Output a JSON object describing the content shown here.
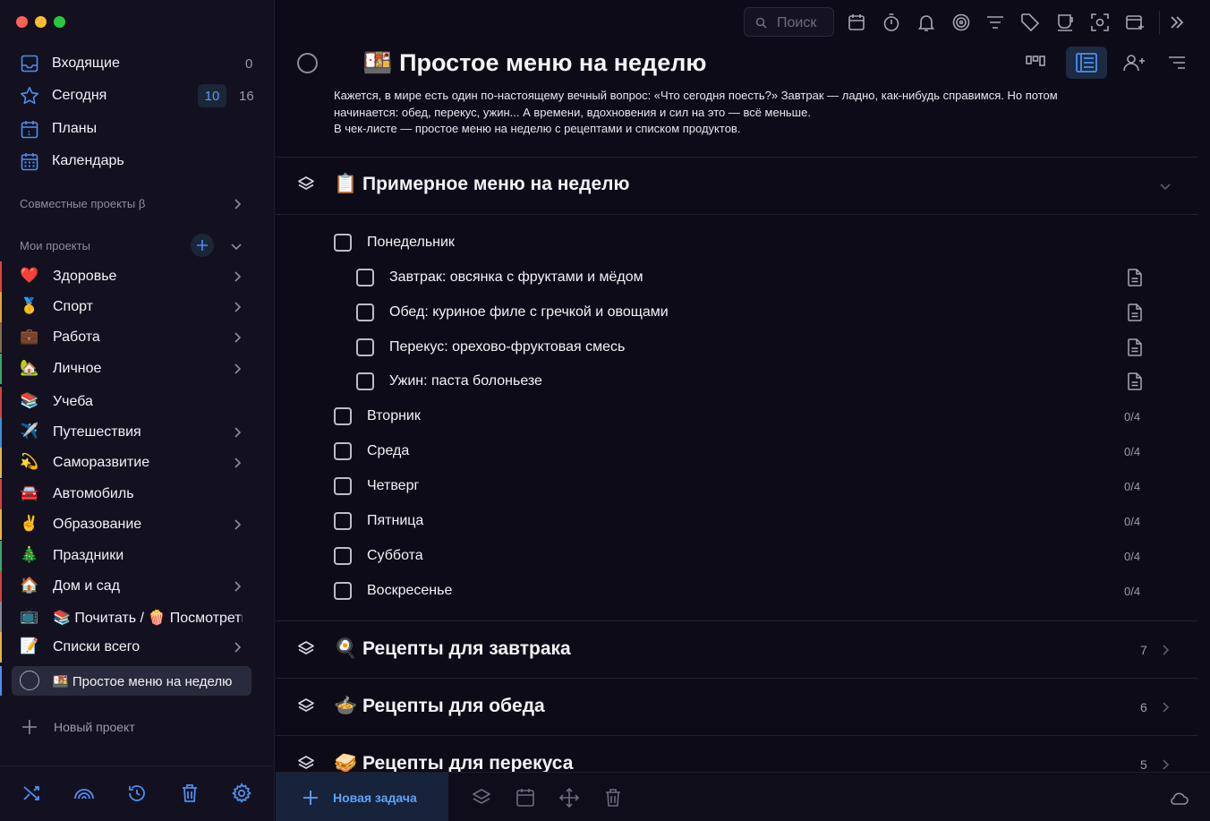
{
  "colors": {
    "accent": "#4c8ff0",
    "red": "#fe5f57",
    "yellow": "#febc2e",
    "green": "#28c840"
  },
  "sidebar": {
    "nav": [
      {
        "label": "Входящие",
        "count": "0",
        "icon": "inbox-icon"
      },
      {
        "label": "Сегодня",
        "badge": "10",
        "count": "16",
        "icon": "star-icon"
      },
      {
        "label": "Планы",
        "icon": "calendar-day-icon"
      },
      {
        "label": "Календарь",
        "icon": "calendar-grid-icon"
      }
    ],
    "shared_label": "Совместные проекты β",
    "my_projects_label": "Мои проекты",
    "projects": [
      {
        "emoji": "❤️",
        "label": "Здоровье",
        "arrow": true,
        "color": "#e0433d"
      },
      {
        "emoji": "🥇",
        "label": "Спорт",
        "arrow": true,
        "color": "#e7a534"
      },
      {
        "emoji": "💼",
        "label": "Работа",
        "arrow": true,
        "color": "#8a6b4a"
      },
      {
        "emoji": "🏡",
        "label": "Личное",
        "arrow": true,
        "color": "#3aa86b"
      },
      {
        "emoji": "📚",
        "label": "Учеба",
        "arrow": false,
        "color": "#d0443d"
      },
      {
        "emoji": "✈️",
        "label": "Путешествия",
        "arrow": true,
        "color": "#3b8ed8"
      },
      {
        "emoji": "💫",
        "label": "Саморазвитие",
        "arrow": true,
        "color": "#e6b53a"
      },
      {
        "emoji": "🚘",
        "label": "Автомобиль",
        "arrow": false,
        "color": "#d0443d"
      },
      {
        "emoji": "✌️",
        "label": "Образование",
        "arrow": true,
        "color": "#e6b53a"
      },
      {
        "emoji": "🎄",
        "label": "Праздники",
        "arrow": false,
        "color": "#3aa86b"
      },
      {
        "emoji": "🏠",
        "label": "Дом и сад",
        "arrow": true,
        "color": "#d0443d"
      },
      {
        "emoji": "📺",
        "label": "📚 Почитать / 🍿 Посмотреть",
        "arrow": false,
        "color": "#8a8a96"
      },
      {
        "emoji": "📝",
        "label": "Списки всего",
        "arrow": true,
        "color": "#e6b53a"
      }
    ],
    "active_project": "🍱 Простое меню на неделю",
    "new_project_label": "Новый проект"
  },
  "toolbar": {
    "search_placeholder": "Поиск"
  },
  "project": {
    "title": "🍱 Простое меню на неделю",
    "description": [
      "Кажется, в мире есть один по-настоящему вечный вопрос: «Что сегодня поесть?» Завтрак — ладно, как-нибудь справимся. Но потом",
      "начинается: обед, перекус, ужин... А времени, вдохновения и сил на это — всё меньше.",
      "В чек-листе — простое меню на неделю с рецептами и списком продуктов."
    ]
  },
  "sections": [
    {
      "title": "📋 Примерное меню на неделю"
    },
    {
      "title": "🍳 Рецепты для завтрака",
      "count": "7"
    },
    {
      "title": "🍲 Рецепты для обеда",
      "count": "6"
    },
    {
      "title": "🥪 Рецепты для перекуса",
      "count": "5"
    }
  ],
  "tasks": [
    {
      "label": "Понедельник",
      "level": 0,
      "progress": ""
    },
    {
      "label": "Завтрак: овсянка с фруктами и мёдом",
      "level": 1,
      "note": true
    },
    {
      "label": "Обед: куриное филе с гречкой и овощами",
      "level": 1,
      "note": true
    },
    {
      "label": "Перекус: орехово-фруктовая смесь",
      "level": 1,
      "note": true
    },
    {
      "label": "Ужин: паста болоньезе",
      "level": 1,
      "note": true
    },
    {
      "label": "Вторник",
      "level": 0,
      "progress": "0/4"
    },
    {
      "label": "Среда",
      "level": 0,
      "progress": "0/4"
    },
    {
      "label": "Четверг",
      "level": 0,
      "progress": "0/4"
    },
    {
      "label": "Пятница",
      "level": 0,
      "progress": "0/4"
    },
    {
      "label": "Суббота",
      "level": 0,
      "progress": "0/4"
    },
    {
      "label": "Воскресенье",
      "level": 0,
      "progress": "0/4"
    }
  ],
  "footer": {
    "new_task_label": "Новая задача"
  }
}
